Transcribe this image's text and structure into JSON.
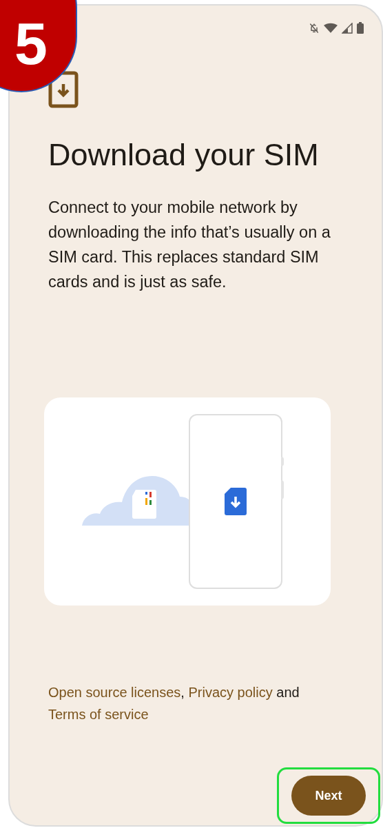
{
  "step_badge": {
    "label": "5"
  },
  "title": "Download your SIM",
  "description": "Connect to your mobile network by downloading the info that’s usually on a SIM card. This replaces standard SIM cards and is just as safe.",
  "legal": [
    {
      "kind": "link",
      "text": "Open source licenses"
    },
    {
      "kind": "text",
      "text": ","
    },
    {
      "kind": "link",
      "text": "Privacy policy"
    },
    {
      "kind": "text",
      "text": "and"
    },
    {
      "kind": "link",
      "text": "Terms of service"
    }
  ],
  "next_button": {
    "label": "Next",
    "highlighted": true
  }
}
